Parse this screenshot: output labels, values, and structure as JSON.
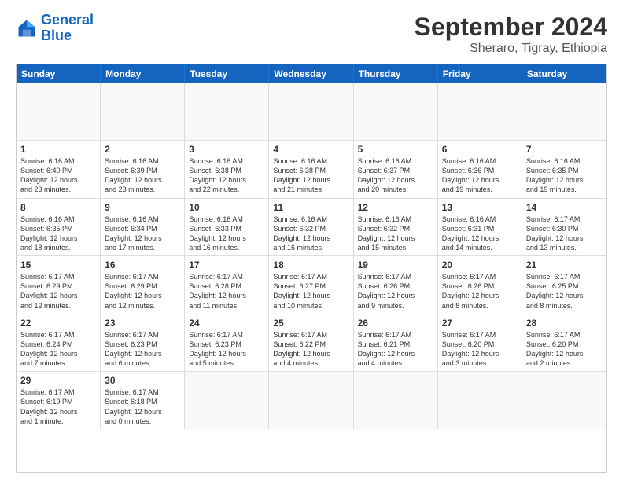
{
  "header": {
    "logo_line1": "General",
    "logo_line2": "Blue",
    "main_title": "September 2024",
    "subtitle": "Sheraro, Tigray, Ethiopia"
  },
  "calendar": {
    "days_of_week": [
      "Sunday",
      "Monday",
      "Tuesday",
      "Wednesday",
      "Thursday",
      "Friday",
      "Saturday"
    ],
    "weeks": [
      [
        {
          "day": "",
          "empty": true,
          "text": ""
        },
        {
          "day": "",
          "empty": true,
          "text": ""
        },
        {
          "day": "",
          "empty": true,
          "text": ""
        },
        {
          "day": "",
          "empty": true,
          "text": ""
        },
        {
          "day": "",
          "empty": true,
          "text": ""
        },
        {
          "day": "",
          "empty": true,
          "text": ""
        },
        {
          "day": "",
          "empty": true,
          "text": ""
        }
      ],
      [
        {
          "day": "1",
          "text": "Sunrise: 6:16 AM\nSunset: 6:40 PM\nDaylight: 12 hours\nand 23 minutes."
        },
        {
          "day": "2",
          "text": "Sunrise: 6:16 AM\nSunset: 6:39 PM\nDaylight: 12 hours\nand 23 minutes."
        },
        {
          "day": "3",
          "text": "Sunrise: 6:16 AM\nSunset: 6:38 PM\nDaylight: 12 hours\nand 22 minutes."
        },
        {
          "day": "4",
          "text": "Sunrise: 6:16 AM\nSunset: 6:38 PM\nDaylight: 12 hours\nand 21 minutes."
        },
        {
          "day": "5",
          "text": "Sunrise: 6:16 AM\nSunset: 6:37 PM\nDaylight: 12 hours\nand 20 minutes."
        },
        {
          "day": "6",
          "text": "Sunrise: 6:16 AM\nSunset: 6:36 PM\nDaylight: 12 hours\nand 19 minutes."
        },
        {
          "day": "7",
          "text": "Sunrise: 6:16 AM\nSunset: 6:35 PM\nDaylight: 12 hours\nand 19 minutes."
        }
      ],
      [
        {
          "day": "8",
          "text": "Sunrise: 6:16 AM\nSunset: 6:35 PM\nDaylight: 12 hours\nand 18 minutes."
        },
        {
          "day": "9",
          "text": "Sunrise: 6:16 AM\nSunset: 6:34 PM\nDaylight: 12 hours\nand 17 minutes."
        },
        {
          "day": "10",
          "text": "Sunrise: 6:16 AM\nSunset: 6:33 PM\nDaylight: 12 hours\nand 16 minutes."
        },
        {
          "day": "11",
          "text": "Sunrise: 6:16 AM\nSunset: 6:32 PM\nDaylight: 12 hours\nand 16 minutes."
        },
        {
          "day": "12",
          "text": "Sunrise: 6:16 AM\nSunset: 6:32 PM\nDaylight: 12 hours\nand 15 minutes."
        },
        {
          "day": "13",
          "text": "Sunrise: 6:16 AM\nSunset: 6:31 PM\nDaylight: 12 hours\nand 14 minutes."
        },
        {
          "day": "14",
          "text": "Sunrise: 6:17 AM\nSunset: 6:30 PM\nDaylight: 12 hours\nand 13 minutes."
        }
      ],
      [
        {
          "day": "15",
          "text": "Sunrise: 6:17 AM\nSunset: 6:29 PM\nDaylight: 12 hours\nand 12 minutes."
        },
        {
          "day": "16",
          "text": "Sunrise: 6:17 AM\nSunset: 6:29 PM\nDaylight: 12 hours\nand 12 minutes."
        },
        {
          "day": "17",
          "text": "Sunrise: 6:17 AM\nSunset: 6:28 PM\nDaylight: 12 hours\nand 11 minutes."
        },
        {
          "day": "18",
          "text": "Sunrise: 6:17 AM\nSunset: 6:27 PM\nDaylight: 12 hours\nand 10 minutes."
        },
        {
          "day": "19",
          "text": "Sunrise: 6:17 AM\nSunset: 6:26 PM\nDaylight: 12 hours\nand 9 minutes."
        },
        {
          "day": "20",
          "text": "Sunrise: 6:17 AM\nSunset: 6:26 PM\nDaylight: 12 hours\nand 8 minutes."
        },
        {
          "day": "21",
          "text": "Sunrise: 6:17 AM\nSunset: 6:25 PM\nDaylight: 12 hours\nand 8 minutes."
        }
      ],
      [
        {
          "day": "22",
          "text": "Sunrise: 6:17 AM\nSunset: 6:24 PM\nDaylight: 12 hours\nand 7 minutes."
        },
        {
          "day": "23",
          "text": "Sunrise: 6:17 AM\nSunset: 6:23 PM\nDaylight: 12 hours\nand 6 minutes."
        },
        {
          "day": "24",
          "text": "Sunrise: 6:17 AM\nSunset: 6:23 PM\nDaylight: 12 hours\nand 5 minutes."
        },
        {
          "day": "25",
          "text": "Sunrise: 6:17 AM\nSunset: 6:22 PM\nDaylight: 12 hours\nand 4 minutes."
        },
        {
          "day": "26",
          "text": "Sunrise: 6:17 AM\nSunset: 6:21 PM\nDaylight: 12 hours\nand 4 minutes."
        },
        {
          "day": "27",
          "text": "Sunrise: 6:17 AM\nSunset: 6:20 PM\nDaylight: 12 hours\nand 3 minutes."
        },
        {
          "day": "28",
          "text": "Sunrise: 6:17 AM\nSunset: 6:20 PM\nDaylight: 12 hours\nand 2 minutes."
        }
      ],
      [
        {
          "day": "29",
          "text": "Sunrise: 6:17 AM\nSunset: 6:19 PM\nDaylight: 12 hours\nand 1 minute."
        },
        {
          "day": "30",
          "text": "Sunrise: 6:17 AM\nSunset: 6:18 PM\nDaylight: 12 hours\nand 0 minutes."
        },
        {
          "day": "",
          "empty": true,
          "text": ""
        },
        {
          "day": "",
          "empty": true,
          "text": ""
        },
        {
          "day": "",
          "empty": true,
          "text": ""
        },
        {
          "day": "",
          "empty": true,
          "text": ""
        },
        {
          "day": "",
          "empty": true,
          "text": ""
        }
      ]
    ]
  }
}
